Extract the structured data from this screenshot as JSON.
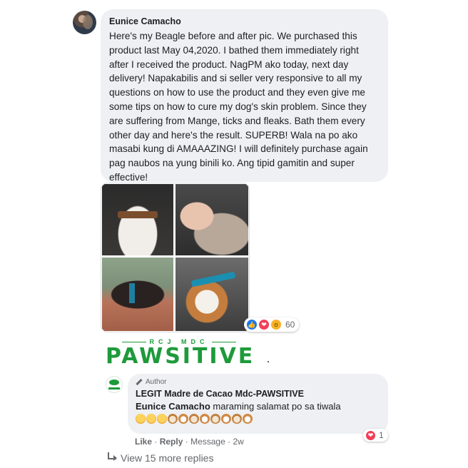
{
  "comment": {
    "author": "Eunice Camacho",
    "text": "Here's my Beagle before and after pic. We purchased this product last May 04,2020. I bathed them immediately right after I received the product. NagPM ako today, next day delivery! Napakabilis and si seller very responsive to all my questions on how to use the product and they even give me some tips on how to cure my dog's skin problem. Since they are suffering from Mange, ticks and fleaks. Bath them every other day and here's the result. SUPERB! Wala na po ako masabi kung di AMAAAZING! I will definitely purchase again pag naubos na yung binili ko. Ang tipid gamitin and super effective!",
    "reaction_count": "60",
    "reaction_icons": [
      "like-icon",
      "love-icon",
      "wow-icon"
    ]
  },
  "logo": {
    "subtitle": "RCJ MDC",
    "title": "PAWSITIVE"
  },
  "reply": {
    "badge": "Author",
    "page_name": "LEGIT Madre de Cacao Mdc-PAWSITIVE",
    "mention": "Eunice Camacho",
    "text": "maraming salamat po sa tiwala",
    "emojis": [
      "face",
      "face",
      "face",
      "dog",
      "cat",
      "dog",
      "cat",
      "dog",
      "cat",
      "dog",
      "cat"
    ],
    "reaction_count": "1",
    "actions": {
      "like": "Like",
      "reply": "Reply",
      "message": "Message",
      "time": "2w"
    }
  },
  "view_more": "View 15 more replies",
  "colors": {
    "brand_green": "#1e9a3b",
    "bubble_bg": "#eef0f3",
    "like_blue": "#1877f2",
    "love_red": "#f33e58"
  }
}
